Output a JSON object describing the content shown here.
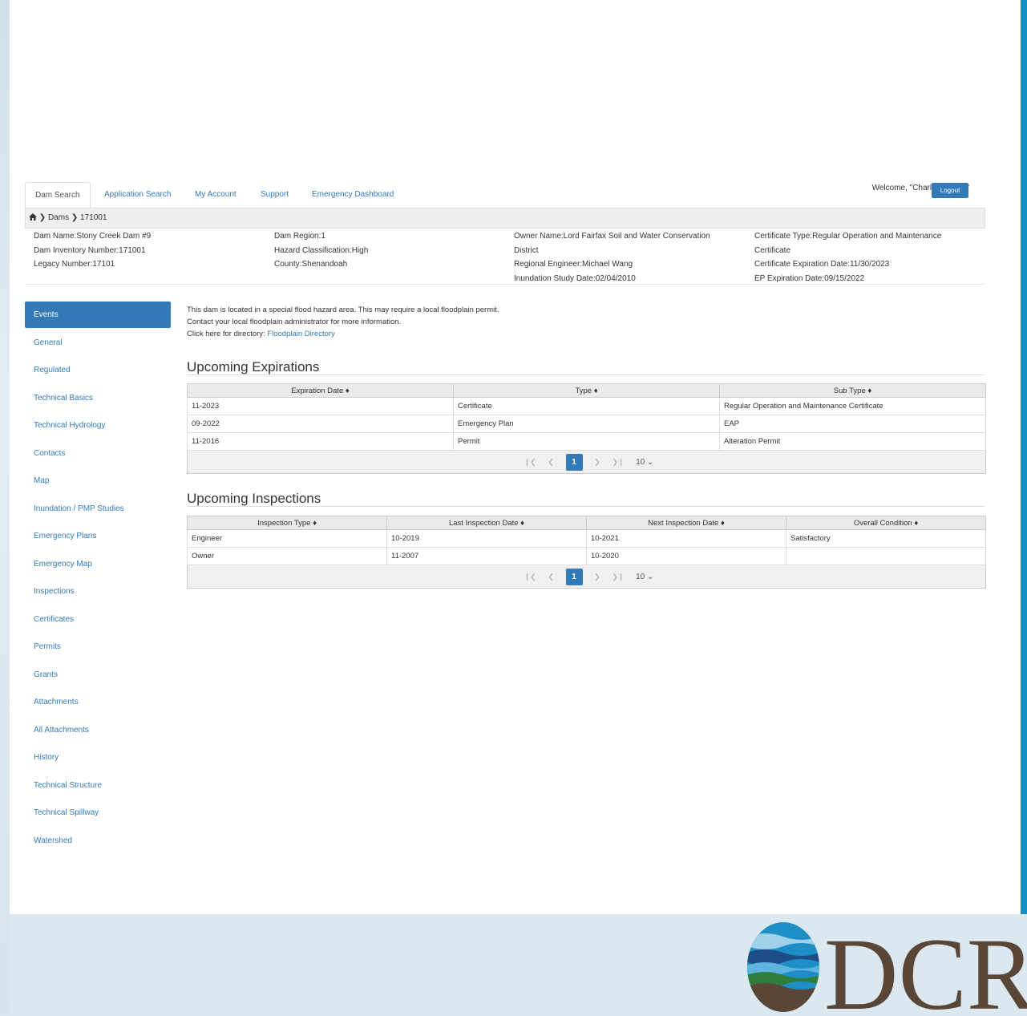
{
  "nav": {
    "tabs": [
      "Dam Search",
      "Application Search",
      "My Account",
      "Support",
      "Emergency Dashboard"
    ],
    "welcome": "Welcome, \"Charles.Wilson\"",
    "logout": "Logout"
  },
  "breadcrumb": {
    "dams": "Dams",
    "current": "171001"
  },
  "dam": {
    "col1": [
      "Dam Name:Stony Creek Dam #9",
      "Dam Inventory Number:171001",
      "Legacy Number:17101"
    ],
    "col2": [
      "Dam Region:1",
      "Hazard Classification:High",
      "County:Shenandoah"
    ],
    "col3": [
      "Owner Name:Lord Fairfax Soil and Water Conservation",
      "District",
      "Regional Engineer:Michael Wang",
      "Inundation Study Date:02/04/2010"
    ],
    "col4": [
      "Certificate Type:Regular Operation and Maintenance",
      "Certificate",
      "Certificate Expiration Date:11/30/2023",
      "EP Expiration Date:09/15/2022"
    ]
  },
  "sidebar": {
    "items": [
      "Events",
      "General",
      "Regulated",
      "Technical Basics",
      "Technical Hydrology",
      "Contacts",
      "Map",
      "Inundation / PMP Studies",
      "Emergency Plans",
      "Emergency Map",
      "Inspections",
      "Certificates",
      "Permits",
      "Grants",
      "Attachments",
      "All Attachments",
      "History",
      "Technical Structure",
      "Technical Spillway",
      "Watershed"
    ]
  },
  "notice": {
    "line1": "This dam is located in a special flood hazard area. This may require a local floodplain permit.",
    "line2": "Contact your local floodplain administrator for more information.",
    "line3_prefix": "Click here for directory: ",
    "link": "Floodplain Directory"
  },
  "expirations": {
    "title": "Upcoming Expirations",
    "headers": [
      "Expiration Date ♦",
      "Type ♦",
      "Sub Type ♦"
    ],
    "rows": [
      [
        "11-2023",
        "Certificate",
        "Regular Operation and Maintenance Certificate"
      ],
      [
        "09-2022",
        "Emergency Plan",
        "EAP"
      ],
      [
        "11-2016",
        "Permit",
        "Alteration Permit"
      ]
    ],
    "page": "1",
    "page_size": "10"
  },
  "inspections": {
    "title": "Upcoming Inspections",
    "headers": [
      "Inspection Type ♦",
      "Last Inspection Date ♦",
      "Next Inspection Date ♦",
      "Overall Condition ♦"
    ],
    "rows": [
      [
        "Engineer",
        "10-2019",
        "10-2021",
        "Satisfactory"
      ],
      [
        "Owner",
        "11-2007",
        "10-2020",
        ""
      ]
    ],
    "page": "1",
    "page_size": "10"
  },
  "logo": {
    "text": "DCR"
  },
  "colors": {
    "primary": "#337ab7",
    "accent": "#1a8cc8",
    "logo_text": "#5a4636"
  },
  "icons": {
    "home": "home-icon",
    "chevron": "chevron-right-icon",
    "dropdown": "chevron-down-icon"
  }
}
